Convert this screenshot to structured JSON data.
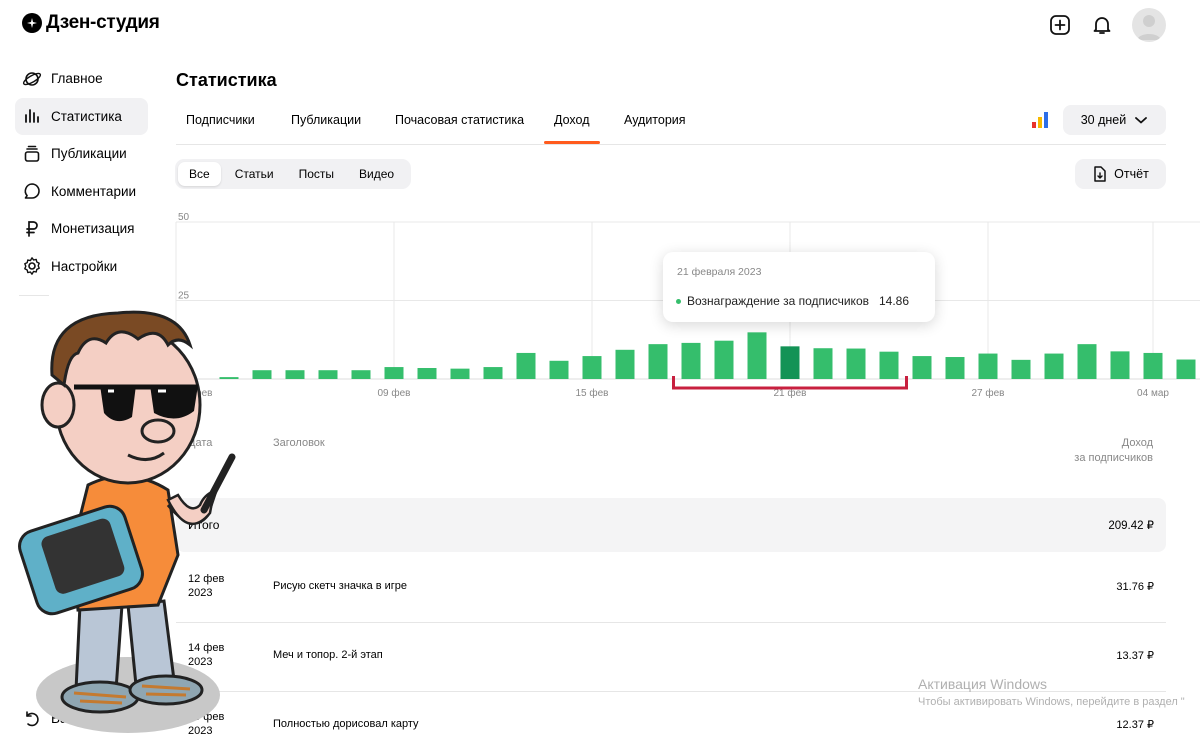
{
  "app": {
    "title": "Дзен-студия"
  },
  "sidebar": {
    "items": [
      {
        "label": "Главное",
        "icon": "planet-icon",
        "active": false
      },
      {
        "label": "Статистика",
        "icon": "bar-chart-icon",
        "active": true
      },
      {
        "label": "Публикации",
        "icon": "stack-icon",
        "active": false
      },
      {
        "label": "Комментарии",
        "icon": "comment-icon",
        "active": false
      },
      {
        "label": "Монетизация",
        "icon": "ruble-icon",
        "active": false
      },
      {
        "label": "Настройки",
        "icon": "gear-icon",
        "active": false
      }
    ],
    "bottom_item": {
      "label": "Ваш канал",
      "icon": "back-arrow-icon"
    }
  },
  "page": {
    "title": "Статистика"
  },
  "tabs": [
    {
      "label": "Подписчики",
      "active": false
    },
    {
      "label": "Публикации",
      "active": false
    },
    {
      "label": "Почасовая статистика",
      "active": false
    },
    {
      "label": "Доход",
      "active": true
    },
    {
      "label": "Аудитория",
      "active": false
    }
  ],
  "period": {
    "selected": "30 дней"
  },
  "filters": [
    {
      "label": "Все",
      "active": true
    },
    {
      "label": "Статьи",
      "active": false
    },
    {
      "label": "Посты",
      "active": false
    },
    {
      "label": "Видео",
      "active": false
    }
  ],
  "report_button": {
    "label": "Отчёт"
  },
  "chart_data": {
    "type": "bar",
    "series": [
      {
        "color": "#35be6c",
        "highlight_color": "#139356",
        "highlight_index": 18
      }
    ],
    "ylim": [
      0,
      50
    ],
    "y_ticks": [
      "50",
      "25"
    ],
    "x_ticks": [
      {
        "index": 0,
        "label": "03 фев"
      },
      {
        "index": 6,
        "label": "09 фев"
      },
      {
        "index": 12,
        "label": "15 фев"
      },
      {
        "index": 18,
        "label": "21 фев"
      },
      {
        "index": 24,
        "label": "27 фев"
      },
      {
        "index": 29,
        "label": "04 мар"
      }
    ],
    "values": [
      0,
      0.6,
      2.8,
      2.8,
      2.8,
      2.8,
      3.8,
      3.5,
      3.3,
      3.8,
      8.3,
      5.8,
      7.3,
      9.3,
      11.1,
      11.5,
      12.2,
      14.86,
      10.4,
      9.8,
      9.7,
      8.7,
      7.3,
      7.0,
      8.1,
      6.1,
      8.1,
      11.1,
      8.8,
      8.3,
      6.2
    ]
  },
  "tooltip": {
    "date": "21 февраля 2023",
    "series_label": "Вознаграждение за подписчиков",
    "value": "14.86"
  },
  "table": {
    "headers": {
      "date": "Дата",
      "title": "Заголовок",
      "income_line1": "Доход",
      "income_line2": "за подписчиков"
    },
    "total": {
      "label": "Итого",
      "value": "209.42 ₽"
    },
    "rows": [
      {
        "date_day": "12 фев",
        "date_year": "2023",
        "title": "Рисую скетч значка в игре",
        "value": "31.76 ₽"
      },
      {
        "date_day": "14 фев",
        "date_year": "2023",
        "title": "Меч и топор. 2-й этап",
        "value": "13.37 ₽"
      },
      {
        "date_day": "20 фев",
        "date_year": "2023",
        "title": "Полностью дорисовал карту",
        "value": "12.37 ₽"
      }
    ]
  },
  "watermark": {
    "title": "Активация Windows",
    "subtitle": "Чтобы активировать Windows, перейдите в раздел \""
  }
}
